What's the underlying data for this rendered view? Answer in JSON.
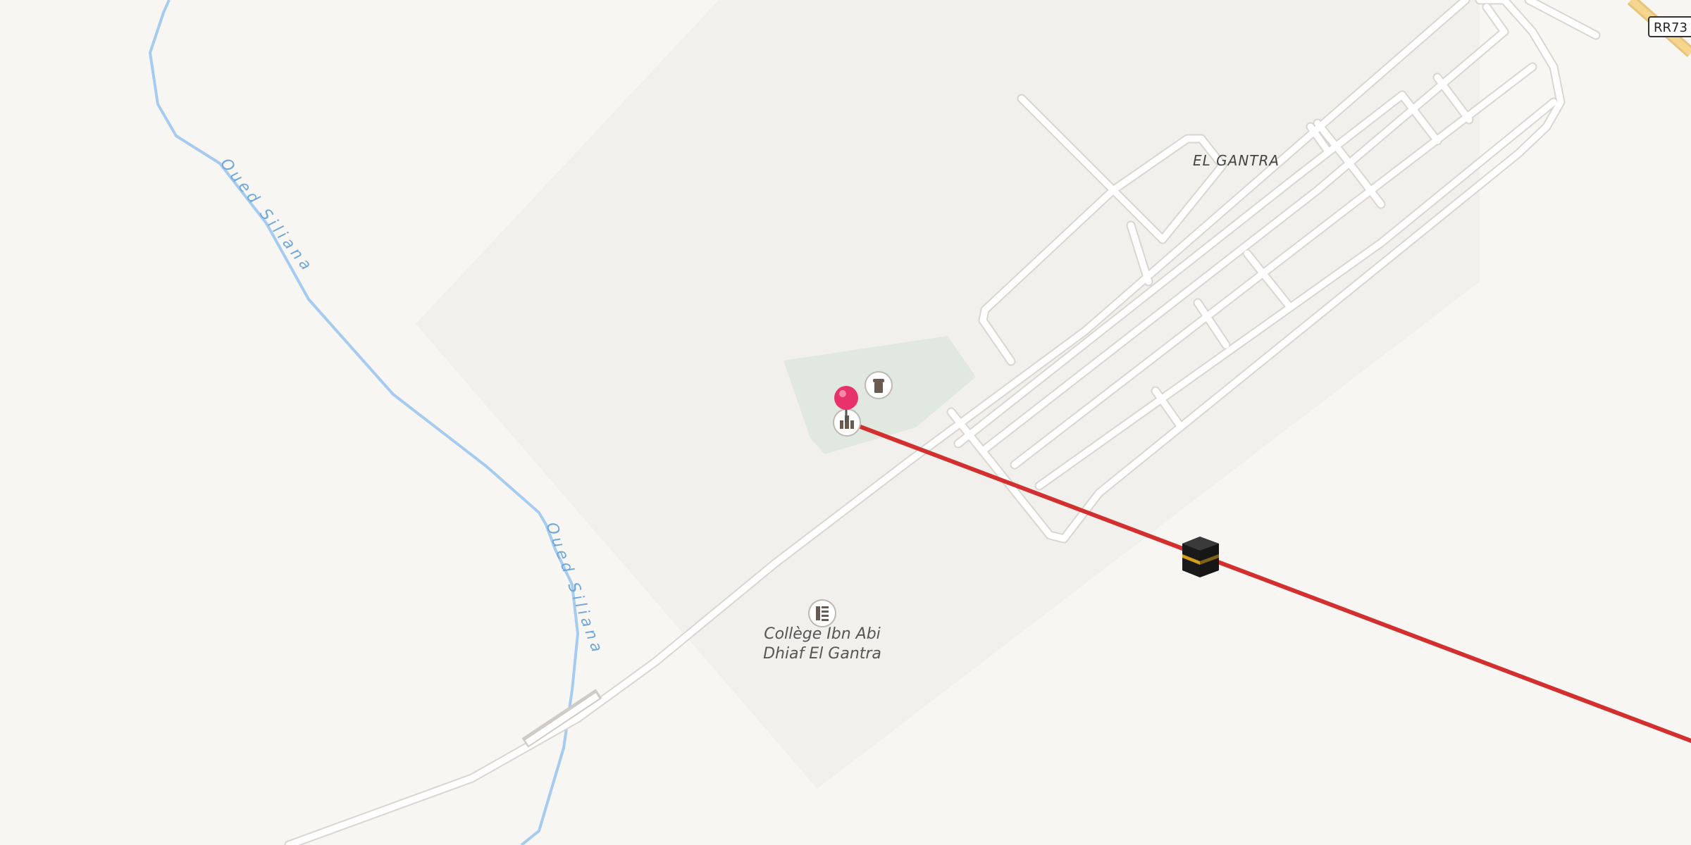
{
  "map": {
    "place_label": "EL GANTRA",
    "road_shield": "RR73",
    "water_labels": [
      "Oued Siliana",
      "Oued Siliana"
    ],
    "poi": {
      "school_name_line1": "Collège Ibn Abi",
      "school_name_line2": "Dhiaf El Gantra",
      "school_icon": "school-icon",
      "mosque_icon": "mosque-icon",
      "cemetery_icon": "cemetery-icon",
      "kaaba_icon": "kaaba-icon"
    },
    "marker": {
      "icon": "location-pin-icon",
      "color": "#e8336a"
    },
    "qibla_line": {
      "color": "#d32f2f"
    },
    "colors": {
      "background": "#f8f6f3",
      "landuse": "#f2f0ec",
      "park": "#e1e8e0",
      "road": "#ffffff",
      "road_casing": "#d9d6d1",
      "river": "#a6cbf0",
      "highway": "#f6d68e"
    }
  }
}
